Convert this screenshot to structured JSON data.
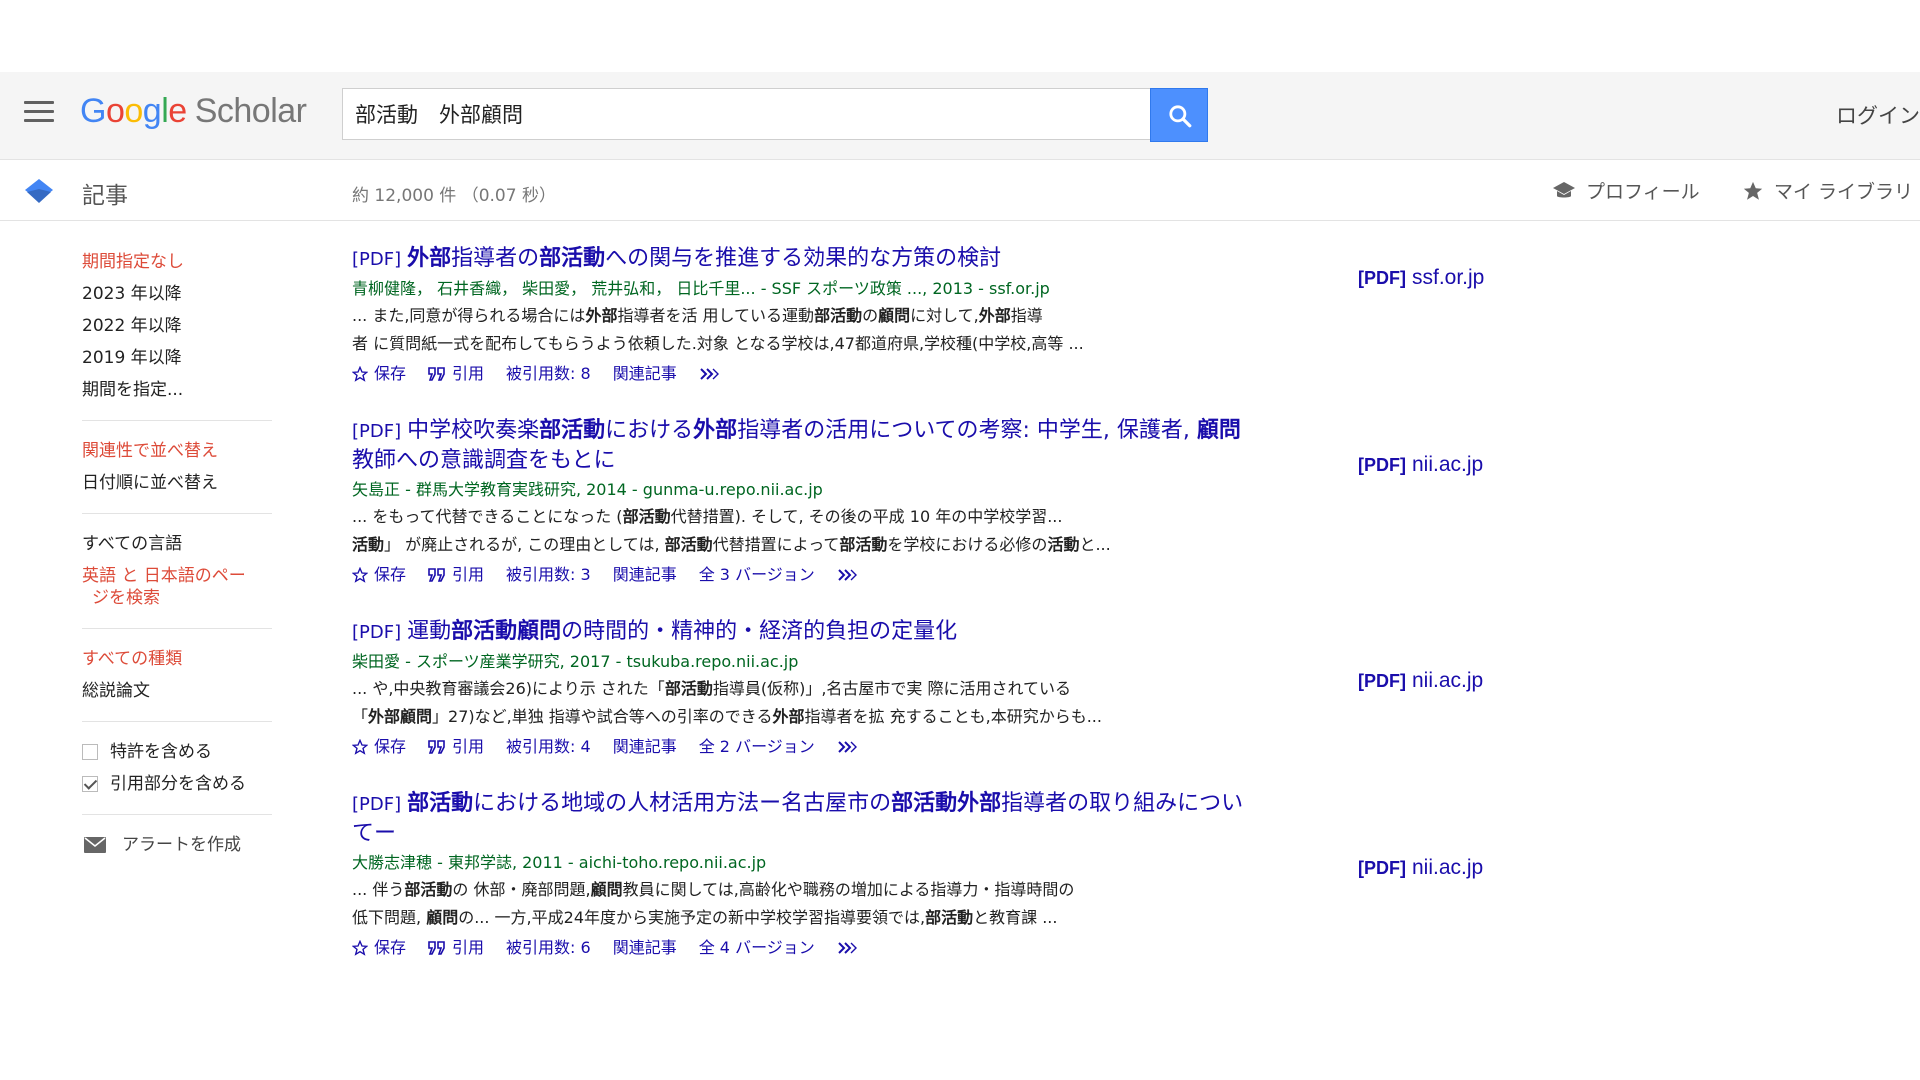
{
  "header": {
    "logo": {
      "google": [
        "G",
        "o",
        "o",
        "g",
        "l",
        "e"
      ],
      "scholar": "Scholar"
    },
    "search_value": "部活動　外部顧問",
    "login": "ログイン"
  },
  "subbar": {
    "articles": "記事",
    "stats": "約 12,000 件 （0.07 秒）",
    "profile": "プロフィール",
    "library": "マイ ライブラリ"
  },
  "sidebar": {
    "time": [
      "期間指定なし",
      "2023 年以降",
      "2022 年以降",
      "2019 年以降",
      "期間を指定..."
    ],
    "sort": [
      "関連性で並べ替え",
      "日付順に並べ替え"
    ],
    "lang_all": "すべての言語",
    "lang_en_ja_1": "英語 と 日本語のペー",
    "lang_en_ja_2": "ジを検索",
    "type_all": "すべての種類",
    "type_review": "総説論文",
    "include_patents": "特許を含める",
    "include_citations": "引用部分を含める",
    "create_alert": "アラートを作成"
  },
  "actions": {
    "save": "保存",
    "cite": "引用"
  },
  "results": [
    {
      "tag": "[PDF]",
      "title_parts": [
        [
          "外部",
          true
        ],
        [
          "指導者の",
          false
        ],
        [
          "部活動",
          true
        ],
        [
          "への関与を推進する効果的な方策の検討",
          false
        ]
      ],
      "meta": "青柳健隆， 石井香織， 柴田愛， 荒井弘和， 日比千里... - SSF スポーツ政策 ..., 2013 - ssf.or.jp",
      "snippet1": [
        [
          "... また,同意が得られる場合には",
          false
        ],
        [
          "外部",
          true
        ],
        [
          "指導者を活 用している運動",
          false
        ],
        [
          "部活動",
          true
        ],
        [
          "の",
          false
        ],
        [
          "顧問",
          true
        ],
        [
          "に対して,",
          false
        ],
        [
          "外部",
          true
        ],
        [
          "指導",
          false
        ]
      ],
      "snippet2": [
        [
          "者 に質問紙一式を配布してもらうよう依頼した.対象 となる学校は,47都道府県,学校種(中学校,高等 ...",
          false
        ]
      ],
      "cited": "被引用数: 8",
      "related": "関連記事",
      "versions": "",
      "side_tag": "[PDF]",
      "side_domain": "ssf.or.jp"
    },
    {
      "tag": "[PDF]",
      "title_parts": [
        [
          "中学校吹奏楽",
          false
        ],
        [
          "部活動",
          true
        ],
        [
          "における",
          false
        ],
        [
          "外部",
          true
        ],
        [
          "指導者の活用についての考察: 中学生, 保護者, ",
          false
        ],
        [
          "顧問",
          true
        ],
        [
          "教師への意識調査をもとに",
          false
        ]
      ],
      "meta": "矢島正 - 群馬大学教育実践研究, 2014 - gunma-u.repo.nii.ac.jp",
      "snippet1": [
        [
          "... をもって代替できることになった (",
          false
        ],
        [
          "部活動",
          true
        ],
        [
          "代替措置). そして, その後の平成 10 年の中学校学習...",
          false
        ]
      ],
      "snippet2": [
        [
          "活動",
          true
        ],
        [
          "」 が廃止されるが, この理由としては, ",
          false
        ],
        [
          "部活動",
          true
        ],
        [
          "代替措置によって",
          false
        ],
        [
          "部活動",
          true
        ],
        [
          "を学校における必修の",
          false
        ],
        [
          "活動",
          true
        ],
        [
          "と...",
          false
        ]
      ],
      "cited": "被引用数: 3",
      "related": "関連記事",
      "versions": "全 3 バージョン",
      "side_tag": "[PDF]",
      "side_domain": "nii.ac.jp"
    },
    {
      "tag": "[PDF]",
      "title_parts": [
        [
          "運動",
          false
        ],
        [
          "部活動顧問",
          true
        ],
        [
          "の時間的・精神的・経済的負担の定量化",
          false
        ]
      ],
      "meta": "柴田愛 - スポーツ産業学研究, 2017 - tsukuba.repo.nii.ac.jp",
      "snippet1": [
        [
          "... や,中央教育審議会26)により示 された「",
          false
        ],
        [
          "部活動",
          true
        ],
        [
          "指導員(仮称)」,名古屋市で実 際に活用されている",
          false
        ]
      ],
      "snippet2": [
        [
          "「",
          false
        ],
        [
          "外部顧問",
          true
        ],
        [
          "」27)など,単独 指導や試合等への引率のできる",
          false
        ],
        [
          "外部",
          true
        ],
        [
          "指導者を拡 充することも,本研究からも...",
          false
        ]
      ],
      "cited": "被引用数: 4",
      "related": "関連記事",
      "versions": "全 2 バージョン",
      "side_tag": "[PDF]",
      "side_domain": "nii.ac.jp"
    },
    {
      "tag": "[PDF]",
      "title_parts": [
        [
          "部活動",
          true
        ],
        [
          "における地域の人材活用方法ー名古屋市の",
          false
        ],
        [
          "部活動外部",
          true
        ],
        [
          "指導者の取り組みについてー",
          false
        ]
      ],
      "meta": "大勝志津穂 - 東邦学誌, 2011 - aichi-toho.repo.nii.ac.jp",
      "snippet1": [
        [
          "... 伴う",
          false
        ],
        [
          "部活動",
          true
        ],
        [
          "の 休部・廃部問題,",
          false
        ],
        [
          "顧問",
          true
        ],
        [
          "教員に関しては,高齢化や職務の増加による指導力・指導時間の",
          false
        ]
      ],
      "snippet2": [
        [
          "低下問題, ",
          false
        ],
        [
          "顧問",
          true
        ],
        [
          "の... 一方,平成24年度から実施予定の新中学校学習指導要領では,",
          false
        ],
        [
          "部活動",
          true
        ],
        [
          "と教育課 ...",
          false
        ]
      ],
      "cited": "被引用数: 6",
      "related": "関連記事",
      "versions": "全 4 バージョン",
      "side_tag": "[PDF]",
      "side_domain": "nii.ac.jp"
    }
  ]
}
